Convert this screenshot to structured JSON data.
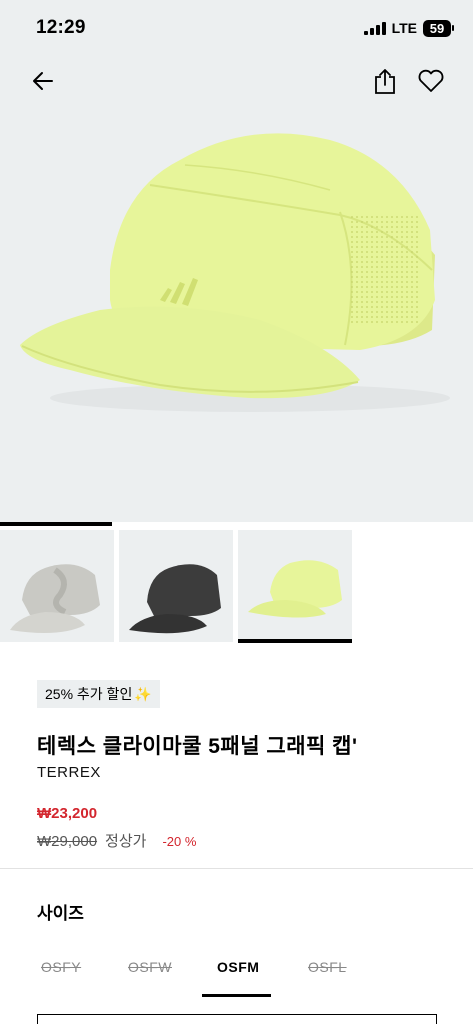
{
  "status": {
    "time": "12:29",
    "network": "LTE",
    "battery": "59"
  },
  "nav": {
    "back_icon": "arrow-left-icon",
    "share_icon": "share-icon",
    "wishlist_icon": "heart-icon"
  },
  "product": {
    "promo": "25% 추가 할인",
    "promo_emoji": "✨",
    "title": "테렉스 클라이마쿨 5패널 그래픽 캡'",
    "brand": "TERREX",
    "sale_price": "₩23,200",
    "original_price": "₩29,000",
    "original_label": "정상가",
    "discount": "-20 %"
  },
  "thumbnails": [
    {
      "variant": "grey-camo",
      "selected": false
    },
    {
      "variant": "black",
      "selected": false
    },
    {
      "variant": "yellow",
      "selected": true
    }
  ],
  "size_section": {
    "title": "사이즈",
    "options": [
      {
        "label": "OSFY",
        "available": false
      },
      {
        "label": "OSFW",
        "available": false
      },
      {
        "label": "OSFM",
        "available": true,
        "selected": true
      },
      {
        "label": "OSFL",
        "available": false
      }
    ]
  },
  "colors": {
    "accent": "#d3262e",
    "cap": "#e7f59a",
    "background": "#eceff0"
  }
}
